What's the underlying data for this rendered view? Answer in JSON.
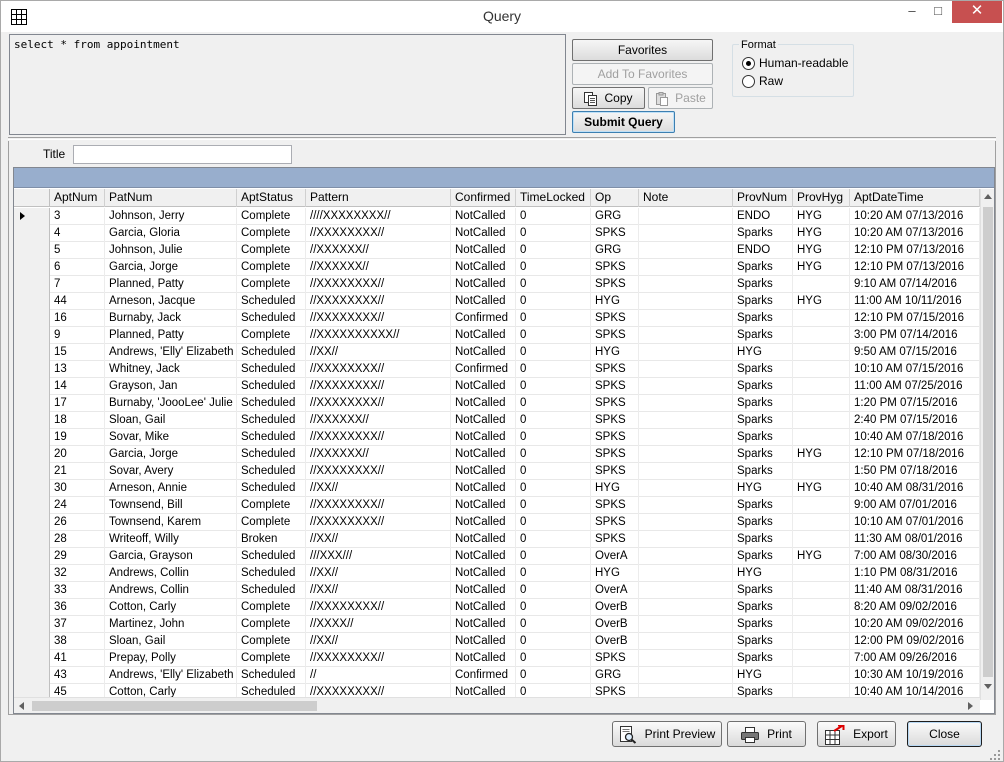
{
  "window": {
    "title": "Query",
    "minimize": "‒",
    "maximize": "□",
    "close": "✕"
  },
  "query": {
    "text": "select * from appointment"
  },
  "buttons": {
    "favorites": "Favorites",
    "add_to_favorites": "Add To Favorites",
    "copy": "Copy",
    "paste": "Paste",
    "submit_query": "Submit Query"
  },
  "format": {
    "legend": "Format",
    "options": [
      "Human-readable",
      "Raw"
    ],
    "selected": "Human-readable"
  },
  "title_field": {
    "label": "Title",
    "value": ""
  },
  "grid": {
    "columns": [
      "AptNum",
      "PatNum",
      "AptStatus",
      "Pattern",
      "Confirmed",
      "TimeLocked",
      "Op",
      "Note",
      "ProvNum",
      "ProvHyg",
      "AptDateTime"
    ],
    "rows": [
      [
        "3",
        "Johnson, Jerry",
        "Complete",
        "////XXXXXXXX//",
        "NotCalled",
        "0",
        "GRG",
        "",
        "ENDO",
        "HYG",
        "10:20 AM   07/13/2016"
      ],
      [
        "4",
        "Garcia, Gloria",
        "Complete",
        "//XXXXXXXX//",
        "NotCalled",
        "0",
        "SPKS",
        "",
        "Sparks",
        "HYG",
        "10:20 AM   07/13/2016"
      ],
      [
        "5",
        "Johnson, Julie",
        "Complete",
        "//XXXXXX//",
        "NotCalled",
        "0",
        "GRG",
        "",
        "ENDO",
        "HYG",
        "12:10 PM   07/13/2016"
      ],
      [
        "6",
        "Garcia, Jorge",
        "Complete",
        "//XXXXXX//",
        "NotCalled",
        "0",
        "SPKS",
        "",
        "Sparks",
        "HYG",
        "12:10 PM   07/13/2016"
      ],
      [
        "7",
        "Planned, Patty",
        "Complete",
        "//XXXXXXXX//",
        "NotCalled",
        "0",
        "SPKS",
        "",
        "Sparks",
        "",
        "9:10 AM   07/14/2016"
      ],
      [
        "44",
        "Arneson, Jacque",
        "Scheduled",
        "//XXXXXXXX//",
        "NotCalled",
        "0",
        "HYG",
        "",
        "Sparks",
        "HYG",
        "11:00 AM   10/11/2016"
      ],
      [
        "16",
        "Burnaby, Jack",
        "Scheduled",
        "//XXXXXXXX//",
        "Confirmed",
        "0",
        "SPKS",
        "",
        "Sparks",
        "",
        "12:10 PM   07/15/2016"
      ],
      [
        "9",
        "Planned, Patty",
        "Complete",
        "//XXXXXXXXXX//",
        "NotCalled",
        "0",
        "SPKS",
        "",
        "Sparks",
        "",
        "3:00 PM   07/14/2016"
      ],
      [
        "15",
        "Andrews, 'Elly' Elizabeth",
        "Scheduled",
        "//XX//",
        "NotCalled",
        "0",
        "HYG",
        "",
        "HYG",
        "",
        "9:50 AM   07/15/2016"
      ],
      [
        "13",
        "Whitney, Jack",
        "Scheduled",
        "//XXXXXXXX//",
        "Confirmed",
        "0",
        "SPKS",
        "",
        "Sparks",
        "",
        "10:10 AM   07/15/2016"
      ],
      [
        "14",
        "Grayson, Jan",
        "Scheduled",
        "//XXXXXXXX//",
        "NotCalled",
        "0",
        "SPKS",
        "",
        "Sparks",
        "",
        "11:00 AM   07/25/2016"
      ],
      [
        "17",
        "Burnaby, 'JoooLee' Julie",
        "Scheduled",
        "//XXXXXXXX//",
        "NotCalled",
        "0",
        "SPKS",
        "",
        "Sparks",
        "",
        "1:20 PM   07/15/2016"
      ],
      [
        "18",
        "Sloan, Gail",
        "Scheduled",
        "//XXXXXX//",
        "NotCalled",
        "0",
        "SPKS",
        "",
        "Sparks",
        "",
        "2:40 PM   07/15/2016"
      ],
      [
        "19",
        "Sovar, Mike",
        "Scheduled",
        "//XXXXXXXX//",
        "NotCalled",
        "0",
        "SPKS",
        "",
        "Sparks",
        "",
        "10:40 AM   07/18/2016"
      ],
      [
        "20",
        "Garcia, Jorge",
        "Scheduled",
        "//XXXXXX//",
        "NotCalled",
        "0",
        "SPKS",
        "",
        "Sparks",
        "HYG",
        "12:10 PM   07/18/2016"
      ],
      [
        "21",
        "Sovar, Avery",
        "Scheduled",
        "//XXXXXXXX//",
        "NotCalled",
        "0",
        "SPKS",
        "",
        "Sparks",
        "",
        "1:50 PM   07/18/2016"
      ],
      [
        "30",
        "Arneson, Annie",
        "Scheduled",
        "//XX//",
        "NotCalled",
        "0",
        "HYG",
        "",
        "HYG",
        "HYG",
        "10:40 AM   08/31/2016"
      ],
      [
        "24",
        "Townsend, Bill",
        "Complete",
        "//XXXXXXXX//",
        "NotCalled",
        "0",
        "SPKS",
        "",
        "Sparks",
        "",
        "9:00 AM   07/01/2016"
      ],
      [
        "26",
        "Townsend, Karem",
        "Complete",
        "//XXXXXXXX//",
        "NotCalled",
        "0",
        "SPKS",
        "",
        "Sparks",
        "",
        "10:10 AM   07/01/2016"
      ],
      [
        "28",
        "Writeoff, Willy",
        "Broken",
        "//XX//",
        "NotCalled",
        "0",
        "SPKS",
        "",
        "Sparks",
        "",
        "11:30 AM   08/01/2016"
      ],
      [
        "29",
        "Garcia, Grayson",
        "Scheduled",
        "///XXX///",
        "NotCalled",
        "0",
        "OverA",
        "",
        "Sparks",
        "HYG",
        "7:00 AM   08/30/2016"
      ],
      [
        "32",
        "Andrews, Collin",
        "Scheduled",
        "//XX//",
        "NotCalled",
        "0",
        "HYG",
        "",
        "HYG",
        "",
        "1:10 PM   08/31/2016"
      ],
      [
        "33",
        "Andrews, Collin",
        "Scheduled",
        "//XX//",
        "NotCalled",
        "0",
        "OverA",
        "",
        "Sparks",
        "",
        "11:40 AM   08/31/2016"
      ],
      [
        "36",
        "Cotton, Carly",
        "Complete",
        "//XXXXXXXX//",
        "NotCalled",
        "0",
        "OverB",
        "",
        "Sparks",
        "",
        "8:20 AM   09/02/2016"
      ],
      [
        "37",
        "Martinez, John",
        "Complete",
        "//XXXX//",
        "NotCalled",
        "0",
        "OverB",
        "",
        "Sparks",
        "",
        "10:20 AM   09/02/2016"
      ],
      [
        "38",
        "Sloan, Gail",
        "Complete",
        "//XX//",
        "NotCalled",
        "0",
        "OverB",
        "",
        "Sparks",
        "",
        "12:00 PM   09/02/2016"
      ],
      [
        "41",
        "Prepay, Polly",
        "Complete",
        "//XXXXXXXX//",
        "NotCalled",
        "0",
        "SPKS",
        "",
        "Sparks",
        "",
        "7:00 AM   09/26/2016"
      ],
      [
        "43",
        "Andrews, 'Elly' Elizabeth",
        "Scheduled",
        "//",
        "Confirmed",
        "0",
        "GRG",
        "",
        "HYG",
        "",
        "10:30 AM   10/19/2016"
      ],
      [
        "45",
        "Cotton, Carly",
        "Scheduled",
        "//XXXXXXXX//",
        "NotCalled",
        "0",
        "SPKS",
        "",
        "Sparks",
        "",
        "10:40 AM   10/14/2016"
      ]
    ]
  },
  "footer": {
    "print_preview": "Print Preview",
    "print": "Print",
    "export": "Export",
    "close": "Close"
  }
}
